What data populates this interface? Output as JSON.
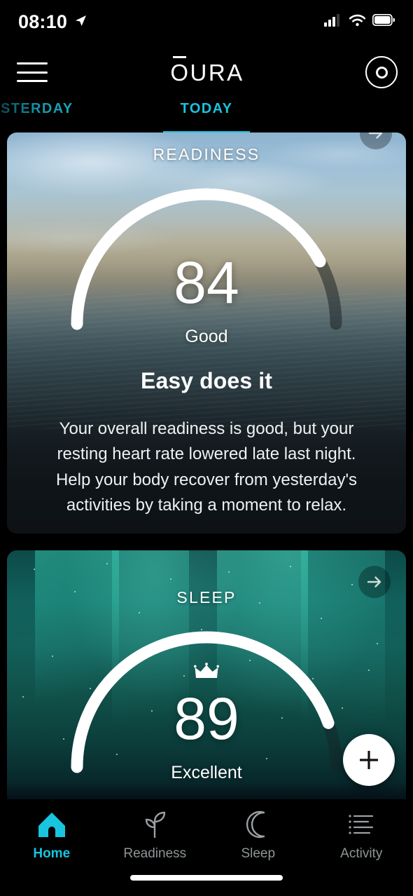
{
  "status_bar": {
    "time": "08:10",
    "location_icon": "location-arrow-icon",
    "signal_icon": "cellular-signal-icon",
    "wifi_icon": "wifi-icon",
    "battery_icon": "battery-full-icon"
  },
  "header": {
    "menu_icon": "hamburger-menu-icon",
    "brand": "OURA",
    "ring_icon": "oura-ring-icon"
  },
  "day_tabs": [
    {
      "label": "YESTERDAY",
      "active": false
    },
    {
      "label": "TODAY",
      "active": true
    }
  ],
  "cards": {
    "readiness": {
      "title": "READINESS",
      "score": "84",
      "score_label": "Good",
      "headline": "Easy does it",
      "body": "Your overall readiness is good, but your resting heart rate lowered late last night. Help your body recover from yesterday's activities by taking a moment to relax.",
      "arrow_icon": "arrow-right-icon",
      "gauge_percent": 84
    },
    "sleep": {
      "title": "SLEEP",
      "score": "89",
      "score_label": "Excellent",
      "crown_icon": "crown-icon",
      "arrow_icon": "arrow-right-icon",
      "gauge_percent": 89
    }
  },
  "fab": {
    "icon": "plus-icon",
    "label": "Add"
  },
  "bottom_nav": [
    {
      "label": "Home",
      "icon": "home-icon",
      "active": true
    },
    {
      "label": "Readiness",
      "icon": "sprout-icon",
      "active": false
    },
    {
      "label": "Sleep",
      "icon": "moon-icon",
      "active": false
    },
    {
      "label": "Activity",
      "icon": "list-icon",
      "active": false
    }
  ],
  "colors": {
    "accent": "#19c4de",
    "background": "#000000",
    "card_dark": "#101518",
    "text_primary": "#ffffff",
    "text_muted": "#8e9496"
  }
}
